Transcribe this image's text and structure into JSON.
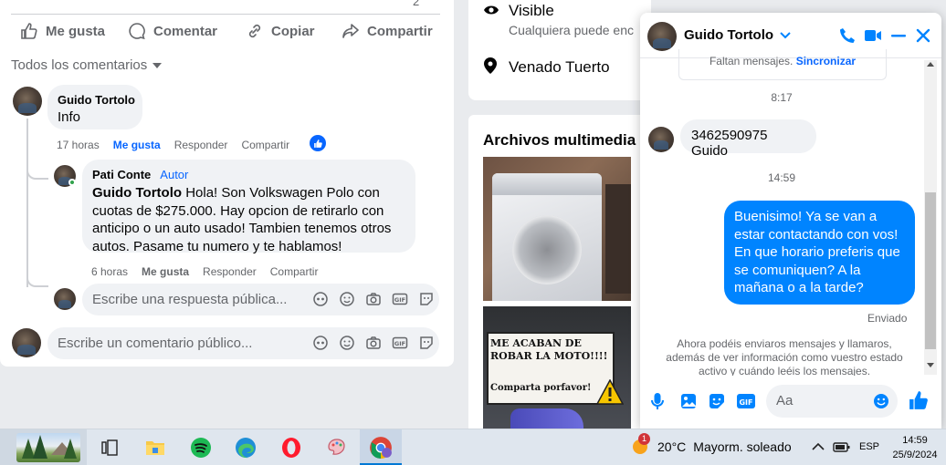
{
  "post": {
    "actions": {
      "like": "Me gusta",
      "comment": "Comentar",
      "copy": "Copiar",
      "share": "Compartir"
    },
    "top_count": "2",
    "comments_filter": "Todos los comentarios",
    "comment1": {
      "author": "Guido Tortolo",
      "text": "Info",
      "time": "17 horas",
      "like": "Me gusta",
      "reply": "Responder",
      "share": "Compartir"
    },
    "reply1": {
      "author": "Pati Conte",
      "badge": "Autor",
      "mention": "Guido Tortolo",
      "text": " Hola! Son Volkswagen Polo con cuotas de $275.000. Hay opcion de retirarlo con anticipo o un auto usado! Tambien tenemos otros autos. Pasame tu numero y te hablamos!",
      "time": "6 horas",
      "like": "Me gusta",
      "reply": "Responder",
      "share": "Compartir"
    },
    "reply_placeholder": "Escribe una respuesta pública...",
    "comment_placeholder": "Escribe un comentario público..."
  },
  "info": {
    "visible_label": "Visible",
    "visible_sub": "Cualquiera puede enc",
    "location": "Venado Tuerto"
  },
  "media": {
    "title": "Archivos multimedia re",
    "thumb2_text1": "ME ACABAN DE ROBAR LA MOTO!!!!",
    "thumb2_text2": "Comparta porfavor!"
  },
  "chat": {
    "name": "Guido Tortolo",
    "missing_text": "Faltan mensajes.",
    "sync_link": "Sincronizar",
    "time1": "8:17",
    "msg_in": "3462590975 Guido",
    "time2": "14:59",
    "msg_out": "Buenisimo! Ya se van a estar contactando con vos! En que horario preferis que se comuniquen? A la mañana o a la tarde?",
    "sent_status": "Enviado",
    "notice": "Ahora podéis enviaros mensajes y llamaros, además de ver información como vuestro estado activo y cuándo leéis los mensajes.",
    "input_placeholder": "Aa"
  },
  "taskbar": {
    "weather_temp": "20°C",
    "weather_text": "Mayorm. soleado",
    "weather_badge": "1",
    "lang": "ESP",
    "time": "14:59",
    "date": "25/9/2024"
  },
  "colors": {
    "fb_blue": "#0866ff",
    "messenger_blue": "#0084ff",
    "taskbar_bg": "#dfe6ee"
  }
}
